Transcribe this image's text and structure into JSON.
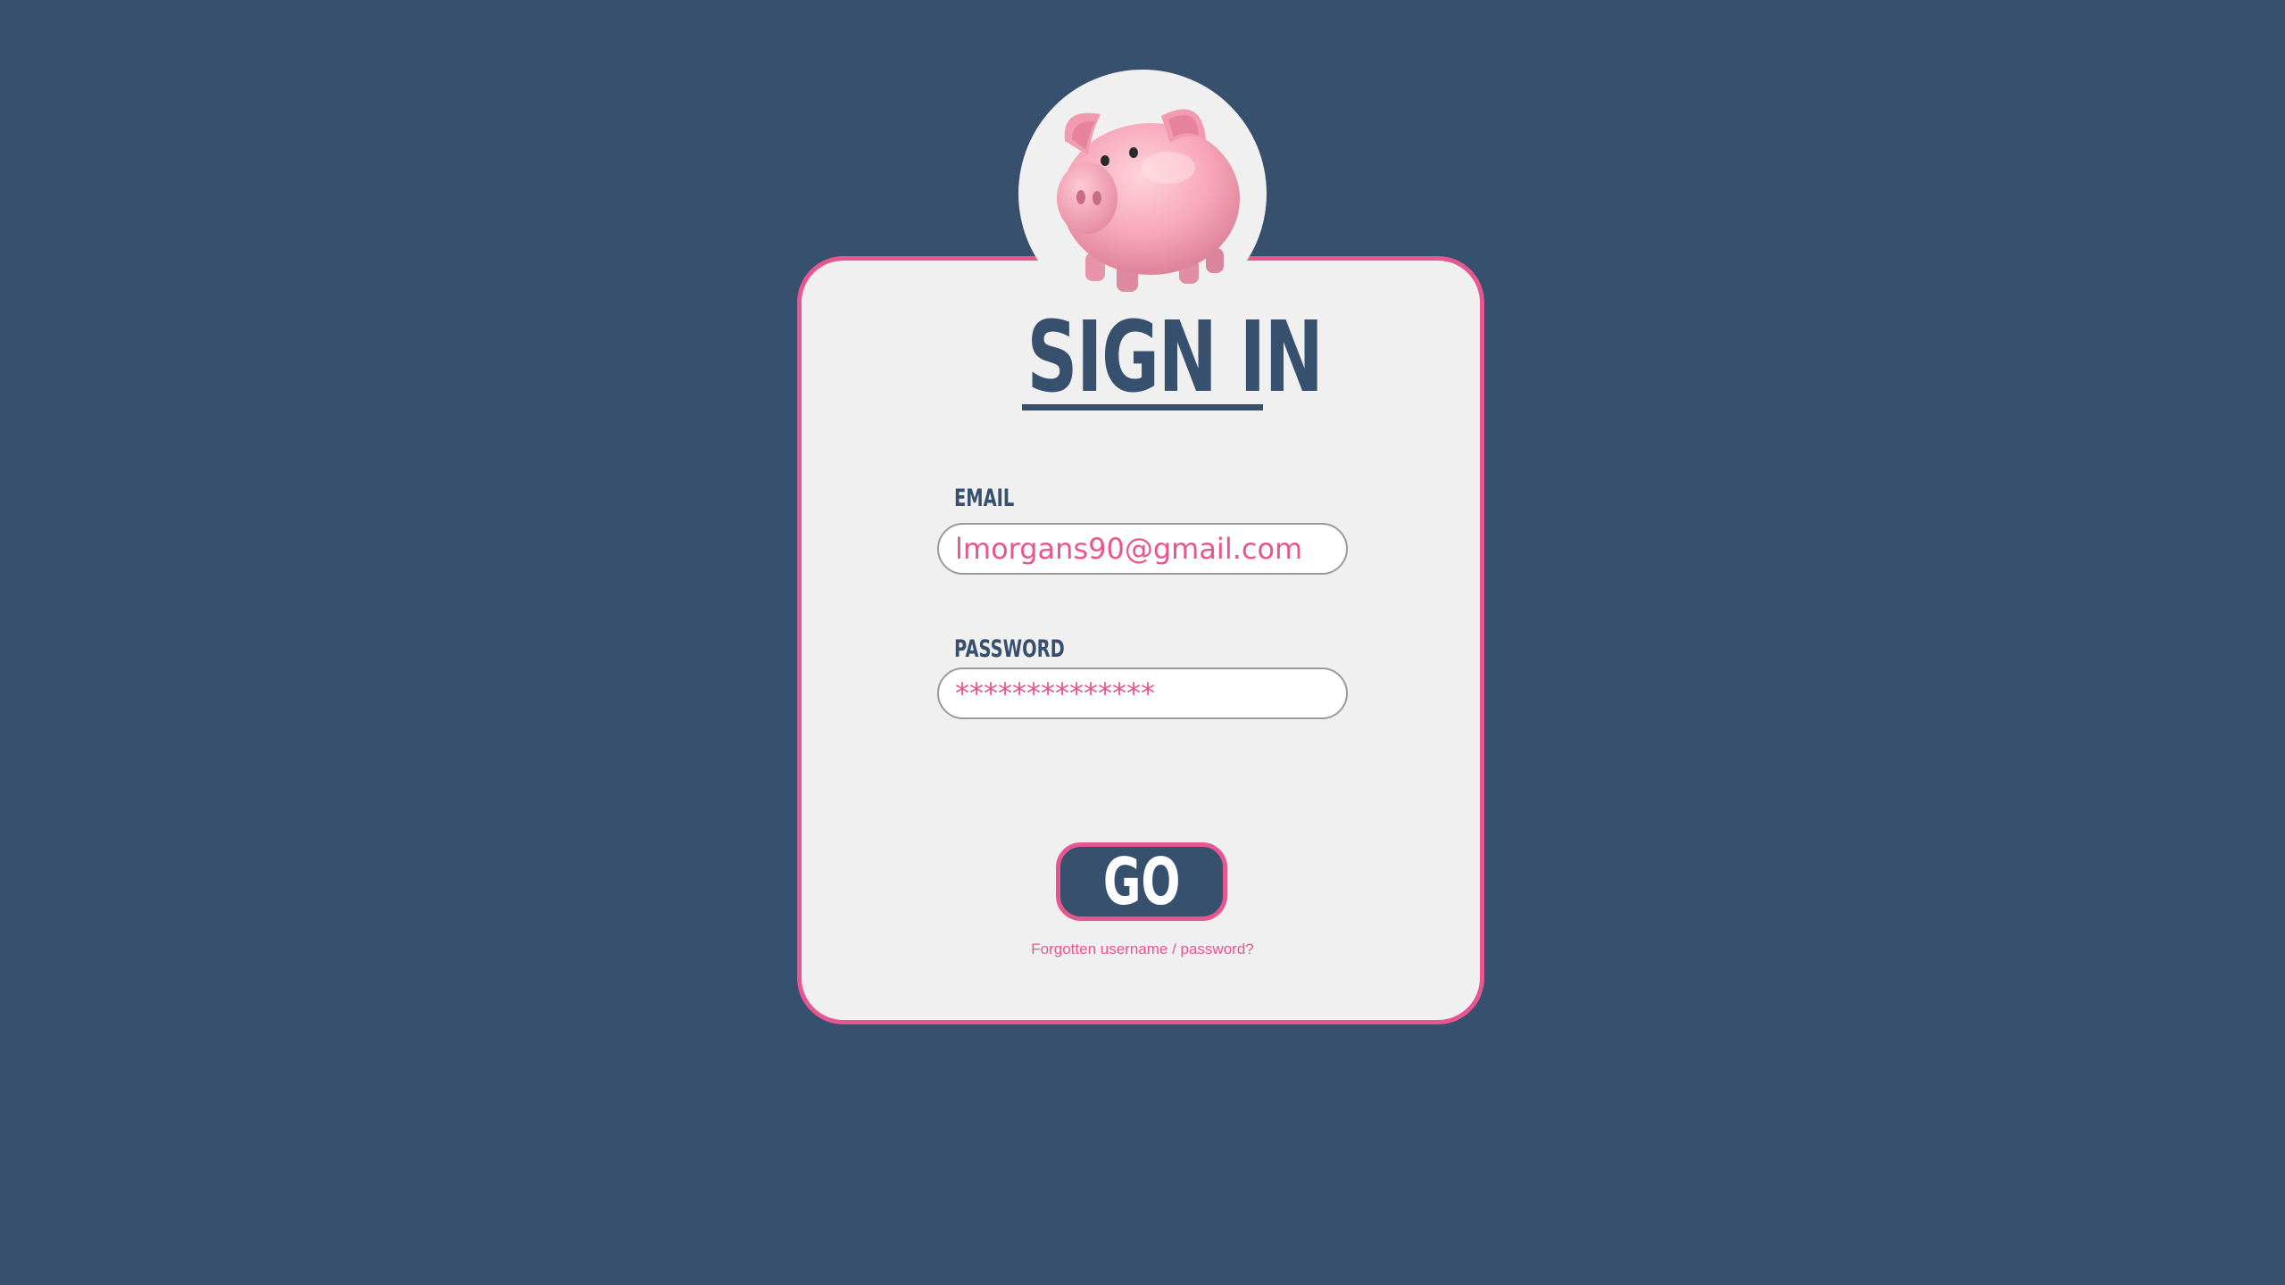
{
  "login": {
    "title": "SIGN IN",
    "email_label": "EMAIL",
    "email_value": "lmorgans90@gmail.com",
    "password_label": "PASSWORD",
    "password_value": "**************",
    "go_label": "GO",
    "forgot_label": "Forgotten username / password?"
  },
  "colors": {
    "background": "#37506e",
    "card": "#f0f0f0",
    "accent": "#e8568f",
    "text_dark": "#37506e"
  },
  "icons": {
    "avatar": "piggy-bank-image"
  }
}
